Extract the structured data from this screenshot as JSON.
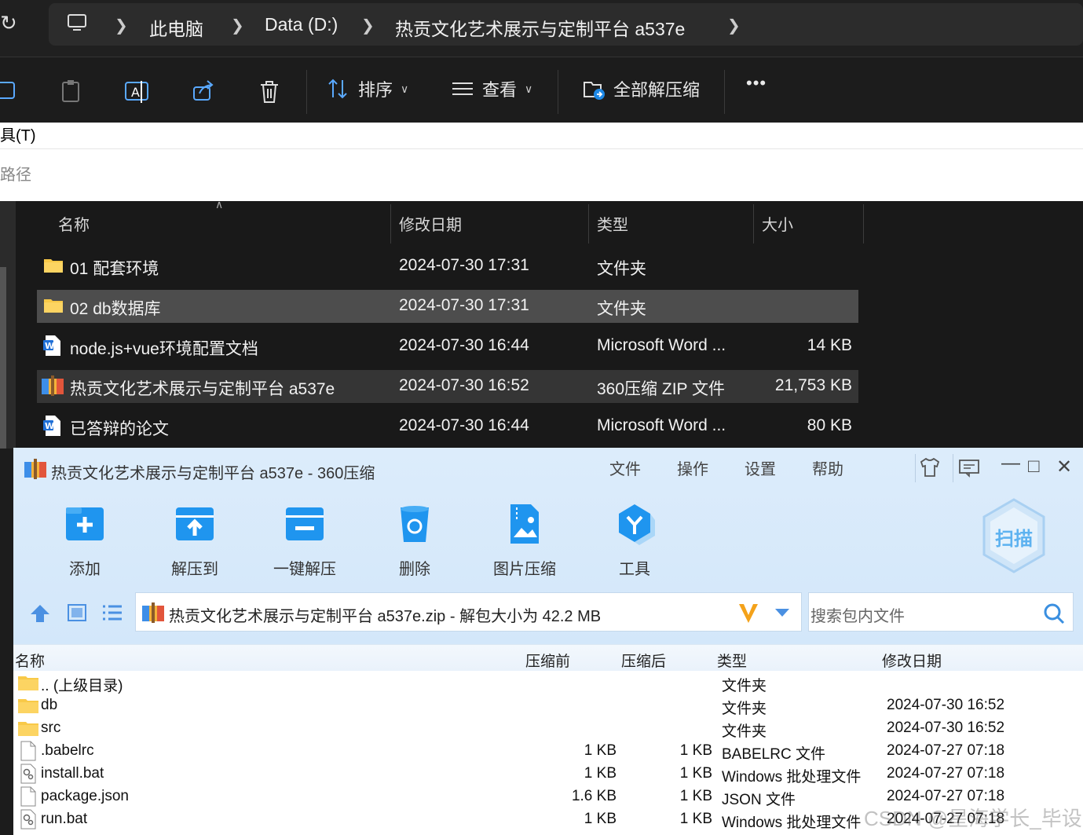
{
  "explorer": {
    "breadcrumb": [
      "此电脑",
      "Data (D:)",
      "热贡文化艺术展示与定制平台 a537e"
    ],
    "commands": {
      "sort": "排序",
      "view": "查看",
      "extract_all": "全部解压缩",
      "more": "•••"
    },
    "menu_fragment": "具(T)",
    "path_fragment": "路径",
    "columns": {
      "name": "名称",
      "modified": "修改日期",
      "type": "类型",
      "size": "大小"
    },
    "files": [
      {
        "name": "01 配套环境",
        "modified": "2024-07-30 17:31",
        "type": "文件夹",
        "size": "",
        "icon": "folder-icon",
        "state": "normal"
      },
      {
        "name": "02 db数据库",
        "modified": "2024-07-30 17:31",
        "type": "文件夹",
        "size": "",
        "icon": "folder-icon",
        "state": "selected"
      },
      {
        "name": "node.js+vue环境配置文档",
        "modified": "2024-07-30 16:44",
        "type": "Microsoft Word ...",
        "size": "14 KB",
        "icon": "word-doc-icon",
        "state": "normal"
      },
      {
        "name": "热贡文化艺术展示与定制平台 a537e",
        "modified": "2024-07-30 16:52",
        "type": "360压缩 ZIP 文件",
        "size": "21,753 KB",
        "icon": "zip-archive-icon",
        "state": "hover"
      },
      {
        "name": "已答辩的论文",
        "modified": "2024-07-30 16:44",
        "type": "Microsoft Word ...",
        "size": "80 KB",
        "icon": "word-doc-icon",
        "state": "normal"
      }
    ]
  },
  "zip_window": {
    "title": "热贡文化艺术展示与定制平台 a537e - 360压缩",
    "menu": [
      "文件",
      "操作",
      "设置",
      "帮助"
    ],
    "toolbar": [
      "添加",
      "解压到",
      "一键解压",
      "删除",
      "图片压缩",
      "工具"
    ],
    "scan_label": "扫描",
    "path": "热贡文化艺术展示与定制平台 a537e.zip - 解包大小为 42.2 MB",
    "search_placeholder": "搜索包内文件",
    "columns": {
      "name": "名称",
      "before": "压缩前",
      "after": "压缩后",
      "type": "类型",
      "modified": "修改日期"
    },
    "entries": [
      {
        "name": ".. (上级目录)",
        "before": "",
        "after": "",
        "type": "文件夹",
        "modified": "",
        "icon": "folder-icon"
      },
      {
        "name": "db",
        "before": "",
        "after": "",
        "type": "文件夹",
        "modified": "2024-07-30 16:52",
        "icon": "folder-icon"
      },
      {
        "name": "src",
        "before": "",
        "after": "",
        "type": "文件夹",
        "modified": "2024-07-30 16:52",
        "icon": "folder-icon"
      },
      {
        "name": ".babelrc",
        "before": "1 KB",
        "after": "1 KB",
        "type": "BABELRC 文件",
        "modified": "2024-07-27 07:18",
        "icon": "file-icon"
      },
      {
        "name": "install.bat",
        "before": "1 KB",
        "after": "1 KB",
        "type": "Windows 批处理文件",
        "modified": "2024-07-27 07:18",
        "icon": "batch-file-icon"
      },
      {
        "name": "package.json",
        "before": "1.6 KB",
        "after": "1 KB",
        "type": "JSON 文件",
        "modified": "2024-07-27 07:18",
        "icon": "file-icon"
      },
      {
        "name": "run.bat",
        "before": "1 KB",
        "after": "1 KB",
        "type": "Windows 批处理文件",
        "modified": "2024-07-27 07:18",
        "icon": "batch-file-icon"
      }
    ]
  },
  "watermark": "CSDN @星海学长_毕设",
  "colors": {
    "explorer_bg": "#191919",
    "selected_row": "#4d4d4d",
    "zip_header_bg": "#d3e7fa",
    "accent_blue": "#1a8be8",
    "folder_yellow": "#f8c948"
  }
}
